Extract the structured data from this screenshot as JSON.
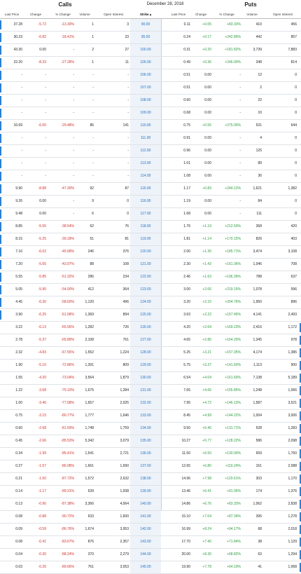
{
  "header": {
    "calls_title": "Calls",
    "puts_title": "Puts",
    "expiration_date": "December 28, 2018"
  },
  "columns": {
    "call_last": "Last Price",
    "call_change": "Change",
    "call_pct": "% Change",
    "call_volume": "Volume",
    "call_oi": "Open Interest",
    "strike": "Strike ▴",
    "put_last": "Last Price",
    "put_change": "Change",
    "put_pct": "% Change",
    "put_volume": "Volume",
    "put_oi": "Open Interest"
  },
  "rows": [
    {
      "cl": "37.28",
      "cc": "-5.72",
      "cp": "-13.30%",
      "cv": "1",
      "co": "3",
      "k": "90.00",
      "pl": "0.11",
      "pc": "+0.05",
      "pp": "+83.33%",
      "pv": "410",
      "po": "456"
    },
    {
      "cl": "30.23",
      "cc": "-6.82",
      "cp": "-18.41%",
      "cv": "1",
      "co": "23",
      "k": "95.00",
      "pl": "0.24",
      "pc": "+0.17",
      "pp": "+242.86%",
      "pv": "442",
      "po": "857"
    },
    {
      "cl": "43.30",
      "cc": "0.00",
      "cp": "-",
      "cv": "2",
      "co": "27",
      "k": "100.00",
      "pl": "0.31",
      "pc": "+0.20",
      "pp": "+181.82%",
      "pv": "3,739",
      "po": "7,883"
    },
    {
      "cl": "22.20",
      "cc": "-8.33",
      "cp": "-27.28%",
      "cv": "1",
      "co": "11",
      "k": "105.00",
      "pl": "0.49",
      "pc": "+0.36",
      "pp": "+246.00%",
      "pv": "348",
      "po": "814"
    },
    {
      "cl": "-",
      "cc": "-",
      "cp": "-",
      "cv": "-",
      "co": "-",
      "k": "106.00",
      "pl": "0.51",
      "pc": "0.00",
      "pp": "-",
      "pv": "12",
      "po": "0"
    },
    {
      "cl": "-",
      "cc": "-",
      "cp": "-",
      "cv": "-",
      "co": "-",
      "k": "107.00",
      "pl": "0.51",
      "pc": "0.00",
      "pp": "-",
      "pv": "2",
      "po": "0"
    },
    {
      "cl": "-",
      "cc": "-",
      "cp": "-",
      "cv": "-",
      "co": "-",
      "k": "108.00",
      "pl": "0.60",
      "pc": "0.00",
      "pp": "-",
      "pv": "22",
      "po": "0"
    },
    {
      "cl": "-",
      "cc": "-",
      "cp": "-",
      "cv": "-",
      "co": "-",
      "k": "109.00",
      "pl": "0.68",
      "pc": "0.00",
      "pp": "-",
      "pv": "10",
      "po": "0"
    },
    {
      "cl": "16.69",
      "cc": "-6.00",
      "cp": "-29.48%",
      "cv": "86",
      "co": "141",
      "k": "110.00",
      "pl": "0.75",
      "pc": "+0.55",
      "pp": "+275.00%",
      "pv": "531",
      "po": "644"
    },
    {
      "cl": "-",
      "cc": "-",
      "cp": "-",
      "cv": "-",
      "co": "-",
      "k": "111.00",
      "pl": "0.91",
      "pc": "0.00",
      "pp": "-",
      "pv": "4",
      "po": "0"
    },
    {
      "cl": "-",
      "cc": "-",
      "cp": "-",
      "cv": "-",
      "co": "-",
      "k": "112.00",
      "pl": "0.96",
      "pc": "0.00",
      "pp": "-",
      "pv": "125",
      "po": "0"
    },
    {
      "cl": "-",
      "cc": "-",
      "cp": "-",
      "cv": "-",
      "co": "-",
      "k": "113.00",
      "pl": "1.01",
      "pc": "0.00",
      "pp": "-",
      "pv": "89",
      "po": "0"
    },
    {
      "cl": "-",
      "cc": "-",
      "cp": "-",
      "cv": "-",
      "co": "-",
      "k": "114.00",
      "pl": "1.08",
      "pc": "0.00",
      "pp": "-",
      "pv": "36",
      "po": "0"
    },
    {
      "cl": "9.90",
      "cc": "-8.88",
      "cp": "-47.30%",
      "cv": "92",
      "co": "87",
      "k": "115.00",
      "pl": "1.17",
      "pc": "+0.83",
      "pp": "+244.12%",
      "pv": "1,621",
      "po": "1,382"
    },
    {
      "cl": "9.26",
      "cc": "0.00",
      "cp": "-",
      "cv": "9",
      "co": "0",
      "k": "116.00",
      "pl": "1.19",
      "pc": "0.00",
      "pp": "-",
      "pv": "84",
      "po": "0"
    },
    {
      "cl": "9.48",
      "cc": "0.00",
      "cp": "-",
      "cv": "6",
      "co": "0",
      "k": "117.00",
      "pl": "1.68",
      "pc": "0.00",
      "pp": "-",
      "pv": "111",
      "po": "0"
    },
    {
      "cl": "8.85",
      "cc": "-5.55",
      "cp": "-38.54%",
      "cv": "62",
      "co": "76",
      "k": "118.00",
      "pl": "1.76",
      "pc": "+1.19",
      "pp": "+212.50%",
      "pv": "368",
      "po": "420"
    },
    {
      "cl": "8.15",
      "cc": "-5.25",
      "cp": "-39.18%",
      "cv": "51",
      "co": "81",
      "k": "119.00",
      "pl": "1.81",
      "pc": "+1.14",
      "pp": "+170.15%",
      "pv": "826",
      "po": "403"
    },
    {
      "cl": "7.16",
      "cc": "-6.02",
      "cp": "-45.68%",
      "cv": "246",
      "co": "376",
      "k": "120.00",
      "pl": "2.00",
      "pc": "+1.30",
      "pp": "+185.71%",
      "pv": "3,474",
      "po": "3,108"
    },
    {
      "cl": "7.20",
      "cc": "-5.65",
      "cp": "-43.97%",
      "cv": "88",
      "co": "108",
      "k": "121.00",
      "pl": "2.30",
      "pc": "+1.42",
      "pp": "+161.36%",
      "pv": "1,046",
      "po": "708"
    },
    {
      "cl": "5.55",
      "cc": "-5.85",
      "cp": "-51.32%",
      "cv": "286",
      "co": "234",
      "k": "122.00",
      "pl": "2.46",
      "pc": "+1.63",
      "pp": "+196.39%",
      "pv": "788",
      "po": "637"
    },
    {
      "cl": "5.05",
      "cc": "-5.90",
      "cp": "-54.00%",
      "cv": "412",
      "co": "364",
      "k": "123.00",
      "pl": "3.00",
      "pc": "+2.06",
      "pp": "+219.15%",
      "pv": "1,078",
      "po": "596"
    },
    {
      "cl": "4.45",
      "cc": "-6.30",
      "cp": "-58.60%",
      "cv": "1,120",
      "co": "496",
      "k": "124.00",
      "pl": "3.20",
      "pc": "+2.15",
      "pp": "+204.76%",
      "pv": "1,950",
      "po": "896"
    },
    {
      "cl": "3.90",
      "cc": "-6.25",
      "cp": "-61.58%",
      "cv": "1,369",
      "co": "894",
      "k": "125.00",
      "pl": "3.63",
      "pc": "+2.22",
      "pp": "+157.45%",
      "pv": "4,141",
      "po": "2,493"
    },
    {
      "cl": "3.22",
      "cc": "-6.13",
      "cp": "-65.56%",
      "cv": "1,282",
      "co": "726",
      "k": "126.00",
      "pl": "4.20",
      "pc": "+2.64",
      "pp": "+169.23%",
      "pv": "2,416",
      "po": "1,172"
    },
    {
      "cl": "2.78",
      "cc": "-5.37",
      "cp": "-65.89%",
      "cv": "2,108",
      "co": "761",
      "k": "127.00",
      "pl": "4.65",
      "pc": "+2.86",
      "pp": "+164.20%",
      "pv": "1,345",
      "po": "978"
    },
    {
      "cl": "2.32",
      "cc": "-4.83",
      "cp": "-67.55%",
      "cv": "1,552",
      "co": "1,224",
      "k": "128.00",
      "pl": "5.25",
      "pc": "+3.21",
      "pp": "+157.35%",
      "pv": "4,174",
      "po": "1,386"
    },
    {
      "cl": "1.90",
      "cc": "-5.10",
      "cp": "-72.86%",
      "cv": "1,391",
      "co": "809",
      "k": "129.00",
      "pl": "5.75",
      "pc": "+3.37",
      "pp": "+141.60%",
      "pv": "1,113",
      "po": "900"
    },
    {
      "cl": "1.55",
      "cc": "-4.20",
      "cp": "-73.04%",
      "cv": "3,564",
      "co": "1,879",
      "k": "130.00",
      "pl": "6.54",
      "pc": "+4.04",
      "pp": "+161.60%",
      "pv": "7,138",
      "po": "5,189"
    },
    {
      "cl": "1.22",
      "cc": "-3.68",
      "cp": "-75.10%",
      "cv": "1,675",
      "co": "1,284",
      "k": "131.00",
      "pl": "7.65",
      "pc": "+4.66",
      "pp": "+155.85%",
      "pv": "1,248",
      "po": "1,066"
    },
    {
      "cl": "1.00",
      "cc": "-3.46",
      "cp": "-77.58%",
      "cv": "1,657",
      "co": "2,025",
      "k": "132.00",
      "pl": "7.95",
      "pc": "+4.72",
      "pp": "+146.13%",
      "pv": "1,587",
      "po": "3,521"
    },
    {
      "cl": "0.75",
      "cc": "-3.15",
      "cp": "-80.77%",
      "cv": "1,777",
      "co": "1,646",
      "k": "133.00",
      "pl": "8.45",
      "pc": "+4.99",
      "pp": "+144.22%",
      "pv": "1,004",
      "po": "3,006"
    },
    {
      "cl": "0.60",
      "cc": "-2.68",
      "cp": "-81.59%",
      "cv": "1,748",
      "co": "1,759",
      "k": "134.00",
      "pl": "9.50",
      "pc": "+5.40",
      "pp": "+131.71%",
      "pv": "528",
      "po": "1,283"
    },
    {
      "cl": "0.45",
      "cc": "-2.66",
      "cp": "-85.53%",
      "cv": "5,342",
      "co": "3,079",
      "k": "135.00",
      "pl": "10.27",
      "pc": "+5.77",
      "pp": "+128.22%",
      "pv": "586",
      "po": "2,098"
    },
    {
      "cl": "0.34",
      "cc": "-1.99",
      "cp": "-85.41%",
      "cv": "1,541",
      "co": "2,721",
      "k": "136.00",
      "pl": "11.50",
      "pc": "+6.50",
      "pp": "+130.00%",
      "pv": "659",
      "po": "1,760"
    },
    {
      "cl": "0.27",
      "cc": "-1.67",
      "cp": "-86.08%",
      "cv": "1,661",
      "co": "1,690",
      "k": "137.00",
      "pl": "12.65",
      "pc": "+6.80",
      "pp": "+116.24%",
      "pv": "161",
      "po": "2,088"
    },
    {
      "cl": "0.21",
      "cc": "-1.50",
      "cp": "-87.72%",
      "cv": "1,572",
      "co": "2,632",
      "k": "138.00",
      "pl": "14.96",
      "pc": "+7.98",
      "pp": "+120.61%",
      "pv": "303",
      "po": "1,170"
    },
    {
      "cl": "0.14",
      "cc": "-1.17",
      "cp": "-89.31%",
      "cv": "639",
      "co": "1,938",
      "k": "139.00",
      "pl": "13.46",
      "pc": "+6.41",
      "pp": "+91.05%",
      "pv": "174",
      "po": "1,376"
    },
    {
      "cl": "0.13",
      "cc": "-0.90",
      "cp": "-87.38%",
      "cv": "3,366",
      "co": "4,064",
      "k": "140.00",
      "pl": "14.86",
      "pc": "+6.76",
      "pp": "+83.33%",
      "pv": "1,062",
      "po": "2,838"
    },
    {
      "cl": "0.08",
      "cc": "-0.88",
      "cp": "-90.72%",
      "cv": "633",
      "co": "1,600",
      "k": "141.00",
      "pl": "15.10",
      "pc": "+7.04",
      "pp": "+87.34%",
      "pv": "395",
      "po": "1,278"
    },
    {
      "cl": "0.09",
      "cc": "-0.59",
      "cp": "-86.76%",
      "cv": "1,674",
      "co": "3,953",
      "k": "142.00",
      "pl": "16.99",
      "pc": "+8.24",
      "pp": "+94.17%",
      "pv": "68",
      "po": "2,018"
    },
    {
      "cl": "0.08",
      "cc": "-0.41",
      "cp": "-83.67%",
      "cv": "876",
      "co": "2,357",
      "k": "143.00",
      "pl": "17.70",
      "pc": "+7.40",
      "pp": "+71.84%",
      "pv": "38",
      "po": "1,129"
    },
    {
      "cl": "0.04",
      "cc": "-0.30",
      "cp": "-88.24%",
      "cv": "370",
      "co": "2,279",
      "k": "144.00",
      "pl": "20.00",
      "pc": "+8.30",
      "pp": "+68.82%",
      "pv": "63",
      "po": "1,294"
    },
    {
      "cl": "0.03",
      "cc": "-0.26",
      "cp": "-89.66%",
      "cv": "761",
      "co": "3,053",
      "k": "145.00",
      "pl": "19.90",
      "pc": "+7.78",
      "pp": "+64.19%",
      "pv": "41",
      "po": "1,068"
    }
  ]
}
